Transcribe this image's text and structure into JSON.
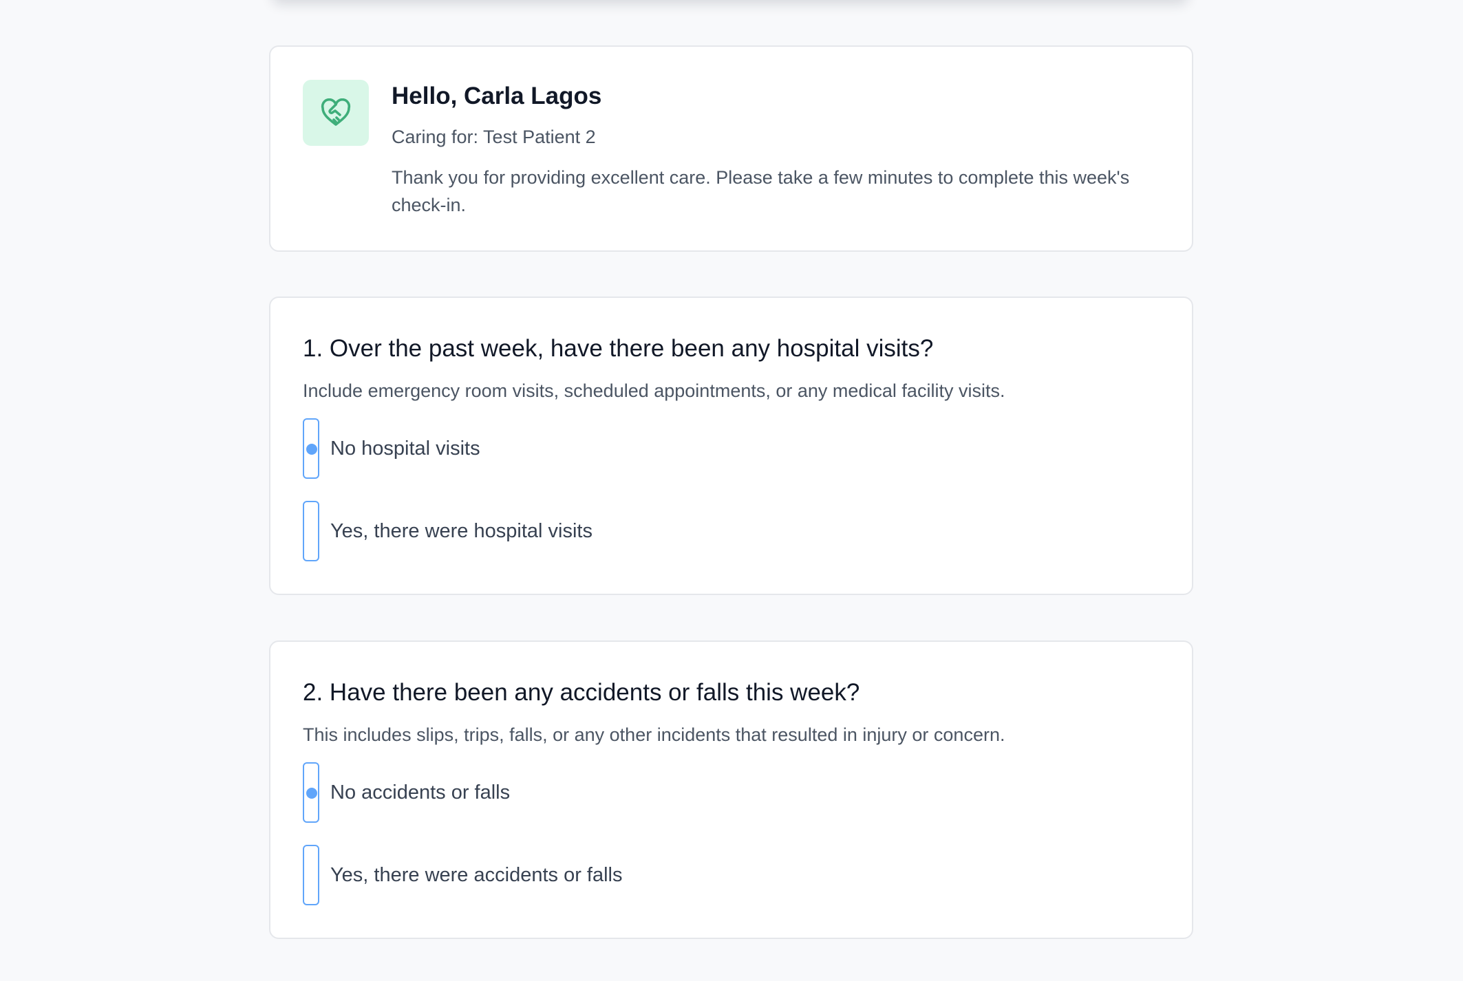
{
  "greeting": {
    "title": "Hello, Carla Lagos",
    "caring_for": "Caring for: Test Patient 2",
    "message": "Thank you for providing excellent care. Please take a few minutes to complete this week's check-in.",
    "icon": "heart-handshake-icon"
  },
  "questions": [
    {
      "title": "1. Over the past week, have there been any hospital visits?",
      "help": "Include emergency room visits, scheduled appointments, or any medical facility visits.",
      "options": [
        {
          "label": "No hospital visits",
          "selected": true
        },
        {
          "label": "Yes, there were hospital visits",
          "selected": false
        }
      ]
    },
    {
      "title": "2. Have there been any accidents or falls this week?",
      "help": "This includes slips, trips, falls, or any other incidents that resulted in injury or concern.",
      "options": [
        {
          "label": "No accidents or falls",
          "selected": true
        },
        {
          "label": "Yes, there were accidents or falls",
          "selected": false
        }
      ]
    }
  ],
  "colors": {
    "accent": "#60a5fa",
    "icon_bg": "#d9f7e8",
    "icon_fg": "#3fae7a"
  }
}
